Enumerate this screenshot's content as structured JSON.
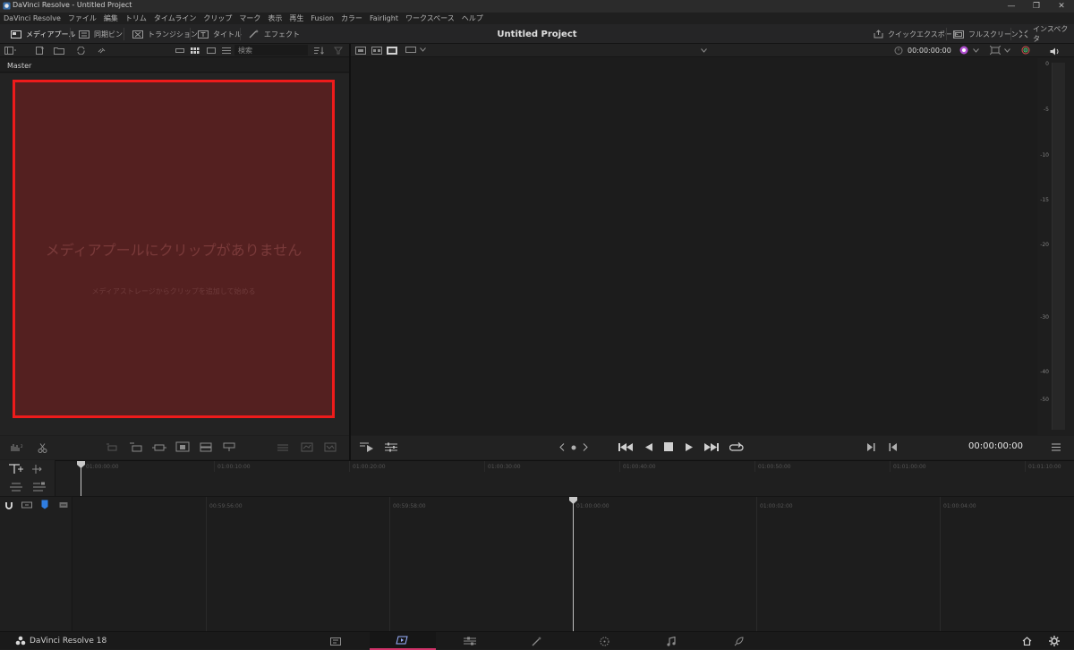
{
  "window": {
    "title": "DaVinci Resolve - Untitled Project",
    "controls": [
      "—",
      "❐",
      "✕"
    ]
  },
  "menu": [
    "DaVinci Resolve",
    "ファイル",
    "編集",
    "トリム",
    "タイムライン",
    "クリップ",
    "マーク",
    "表示",
    "再生",
    "Fusion",
    "カラー",
    "Fairlight",
    "ワークスペース",
    "ヘルプ"
  ],
  "toolbar": {
    "media_pool": "メディアプール",
    "sync_bin": "同期ビン",
    "transitions": "トランジション",
    "titles": "タイトル",
    "effects": "エフェクト",
    "project_title": "Untitled Project",
    "quick_export": "クイックエクスポート",
    "fullscreen": "フルスクリーン",
    "inspector": "インスペクタ"
  },
  "search": {
    "placeholder": "検索"
  },
  "viewer": {
    "timecode": "00:00:00:00"
  },
  "mediapool": {
    "bin_name": "Master",
    "empty_title": "メディアプールにクリップがありません",
    "empty_hint": "メディアストレージからクリップを追加して始める"
  },
  "meter": {
    "labels": [
      "0",
      "-5",
      "-10",
      "-15",
      "-20",
      "-30",
      "-40",
      "-50"
    ]
  },
  "transport": {
    "timecode": "00:00:00:00"
  },
  "timeline": {
    "upper_ticks": [
      "01:00:00:00",
      "01:00:10:00",
      "01:00:20:00",
      "01:00:30:00",
      "01:00:40:00",
      "01:00:50:00",
      "01:01:00:00",
      "01:01:10:00"
    ],
    "lower_ticks": [
      "00:59:56:00",
      "00:59:58:00",
      "01:00:00:00",
      "01:00:02:00",
      "01:00:04:00"
    ]
  },
  "bottom": {
    "app_name": "DaVinci Resolve 18"
  },
  "colors": {
    "accent": "#d0336a",
    "highlight_border": "#ee1b1b",
    "timecode": "#e6e6e6"
  }
}
